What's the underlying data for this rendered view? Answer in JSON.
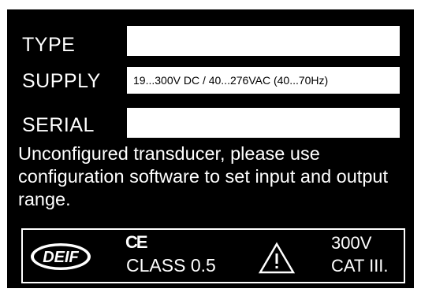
{
  "fields": {
    "type_label": "TYPE",
    "type_value": "",
    "supply_label": "SUPPLY",
    "supply_value": "19...300V DC / 40...276VAC (40...70Hz)",
    "serial_label": "SERIAL",
    "serial_value": ""
  },
  "message": "Unconfigured transducer, please use configuration software to set input and output range.",
  "footer": {
    "logo_text": "DEIF",
    "ce_mark": "CE",
    "class_text": "CLASS 0.5",
    "warning_icon": "warning-triangle-icon",
    "voltage": "300V",
    "category": "CAT III."
  },
  "colors": {
    "plate": "#000000",
    "text": "#ffffff",
    "field": "#ffffff"
  }
}
